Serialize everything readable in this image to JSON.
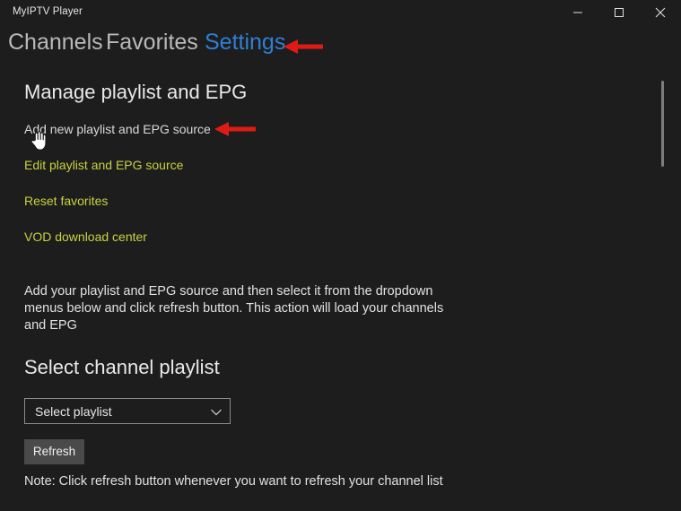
{
  "window": {
    "title": "MyIPTV Player",
    "background_color": "#1d1d1d",
    "controls": {
      "minimize_label": "minimize",
      "maximize_label": "maximize",
      "close_label": "close"
    }
  },
  "tabs": [
    {
      "label": "Channels",
      "active": false
    },
    {
      "label": "Favorites",
      "active": false
    },
    {
      "label": "Settings",
      "active": true
    }
  ],
  "colors": {
    "active_tab": "#2f7fd4",
    "inactive_tab": "#b9b9b9",
    "link": "#c8d23f",
    "link_hover": "#d9d9d9",
    "annotation_arrow": "#e01b16",
    "button_face": "#4a4a4a"
  },
  "main": {
    "manage_section": {
      "heading": "Manage playlist and EPG",
      "links": [
        {
          "label": "Add new playlist and EPG source",
          "state": "hovered"
        },
        {
          "label": "Edit playlist and EPG source",
          "state": "normal"
        },
        {
          "label": "Reset favorites",
          "state": "normal"
        },
        {
          "label": "VOD download center",
          "state": "normal"
        }
      ]
    },
    "description": "Add your playlist and EPG source and then select it from the dropdown menus below and click refresh button. This action will load your channels and EPG",
    "playlist_section": {
      "heading": "Select channel playlist",
      "dropdown": {
        "selected": "Select playlist",
        "placeholder": "Select playlist"
      },
      "refresh_button": "Refresh",
      "note": "Note: Click refresh button whenever you want to refresh your channel list"
    }
  },
  "annotations": [
    {
      "name": "arrow-to-settings-tab",
      "points_to": "Settings"
    },
    {
      "name": "arrow-to-add-playlist-link",
      "points_to": "Add new playlist and EPG source"
    }
  ],
  "cursor": {
    "type": "hand-pointer"
  }
}
